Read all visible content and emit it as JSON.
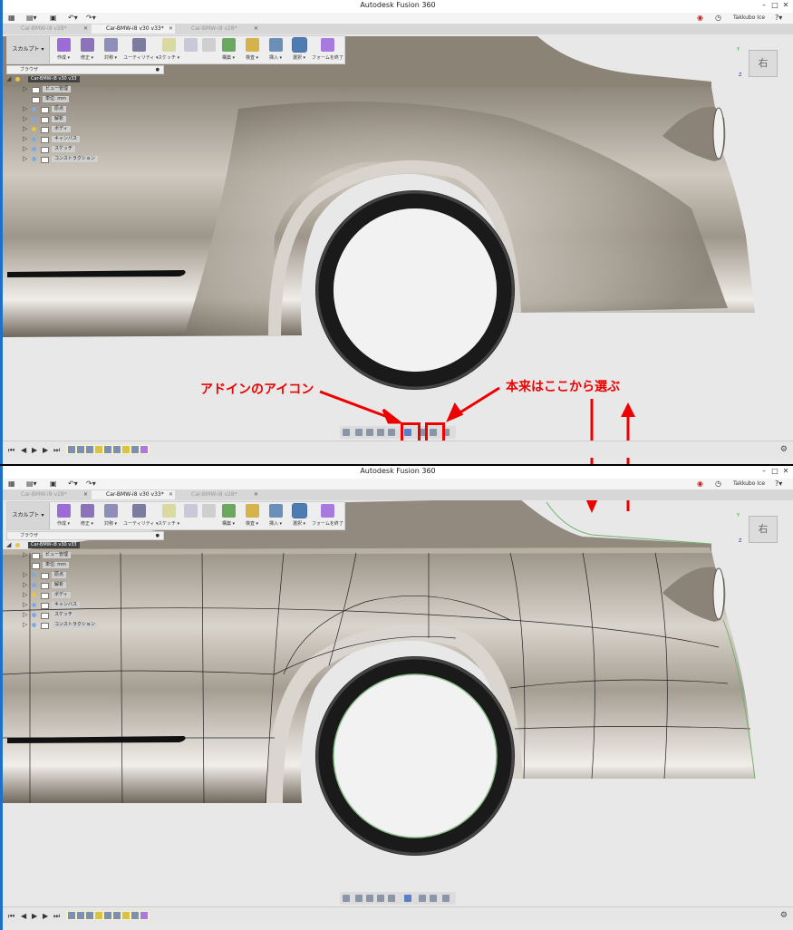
{
  "app": {
    "title": "Autodesk Fusion 360",
    "user": "Takkubo Ice",
    "help": "?"
  },
  "tabs": [
    {
      "label": "Car-BMW-i8 v28*",
      "active": false
    },
    {
      "label": "Car-BMW-i8 v30 v33*",
      "active": true
    },
    {
      "label": "Car-BMW-i8 v28*",
      "active": false
    }
  ],
  "toolbar": {
    "workspace": "スカルプト ▾",
    "tools": [
      "作成 ▾",
      "修正 ▾",
      "対称 ▾",
      "ユーティリティ ▾",
      "スケッチ ▾",
      "",
      "",
      "構築 ▾",
      "検査 ▾",
      "挿入 ▾",
      "選択 ▾",
      "フォームを終了"
    ]
  },
  "browser": {
    "header": "ブラウザ",
    "root": "Car-BMW-i8 v30 v33",
    "items": [
      "ビュー管理",
      "単位: mm",
      "原点",
      "解析",
      "ボディ",
      "キャンバス",
      "スケッチ",
      "コンストラクション"
    ]
  },
  "viewcube": {
    "label": "右"
  },
  "annotations": {
    "addin_icon": "アドインのアイコン",
    "choose_here": "本来はここから選ぶ"
  },
  "playback": [
    "⏮",
    "◀",
    "▶",
    "▶",
    "⏭"
  ],
  "colors": {
    "annotation": "#e00000",
    "tire": "#1a1a1a",
    "body": "#b9b1a4",
    "accent": "#1e6fc8"
  }
}
